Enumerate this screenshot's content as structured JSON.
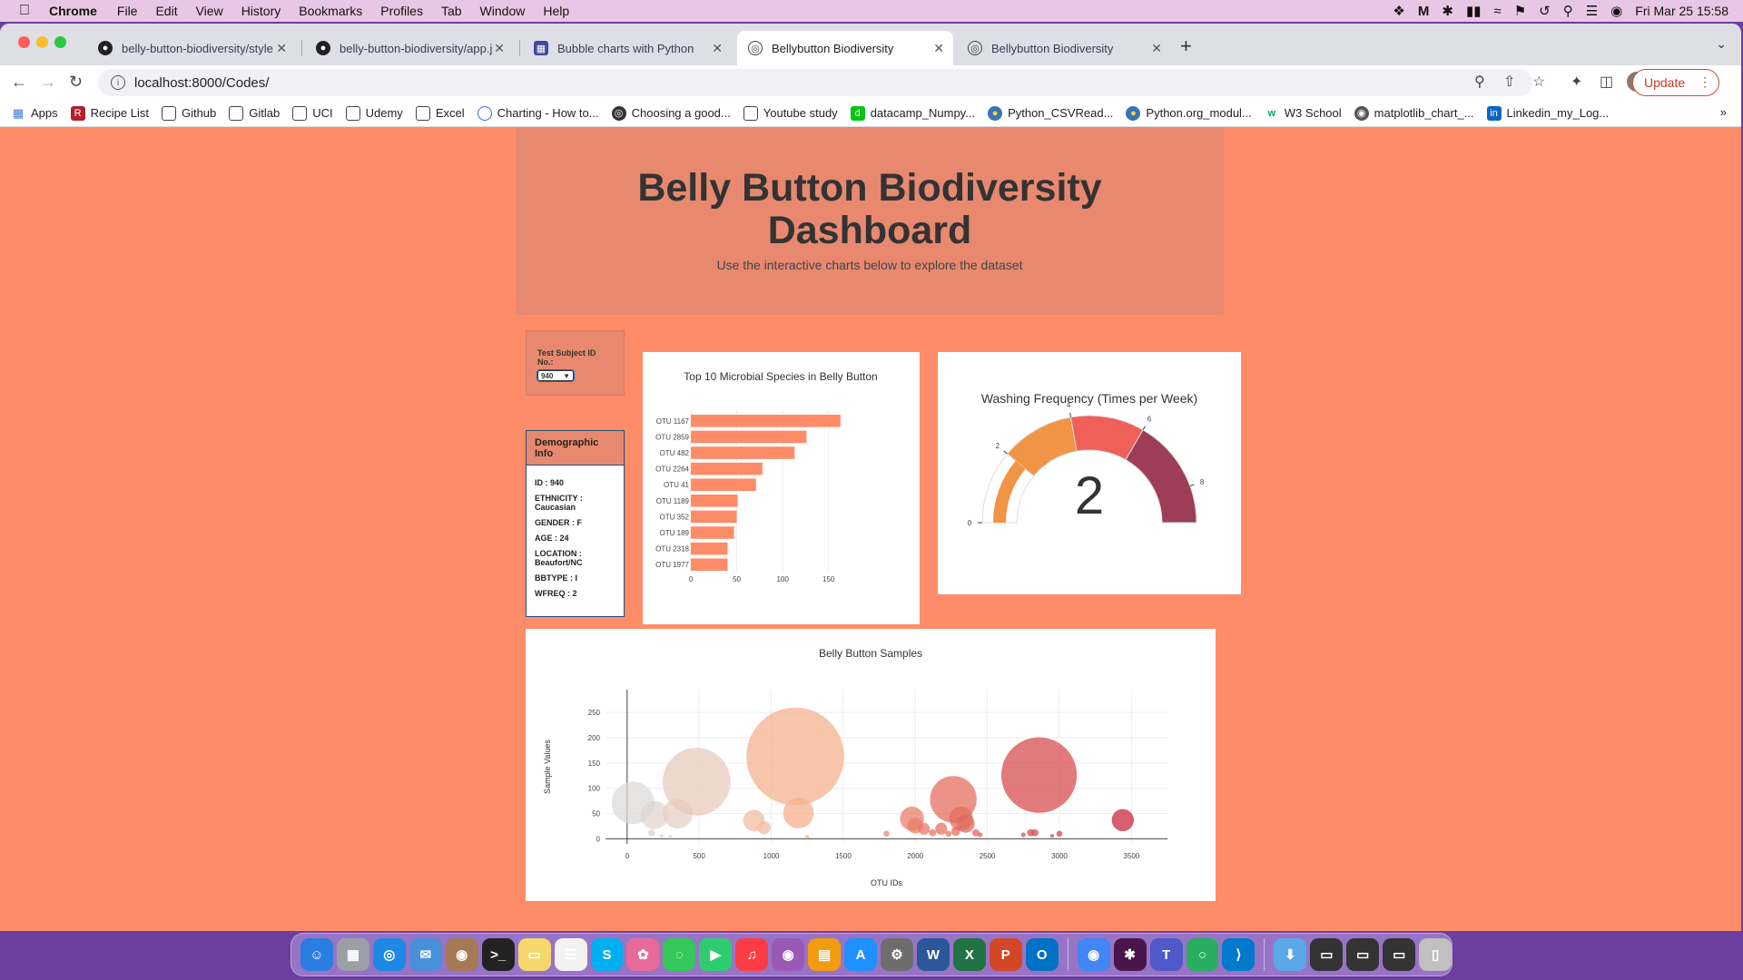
{
  "menubar": {
    "app": "Chrome",
    "items": [
      "File",
      "Edit",
      "View",
      "History",
      "Bookmarks",
      "Profiles",
      "Tab",
      "Window",
      "Help"
    ],
    "datetime": "Fri Mar 25  15:58"
  },
  "tabs": [
    {
      "label": "belly-button-biodiversity/style",
      "icon": "github-icon"
    },
    {
      "label": "belly-button-biodiversity/app.j",
      "icon": "github-icon"
    },
    {
      "label": "Bubble charts with Python",
      "icon": "plotly-icon"
    },
    {
      "label": "Bellybutton Biodiversity",
      "icon": "globe-icon",
      "active": true
    },
    {
      "label": "Bellybutton Biodiversity",
      "icon": "globe-icon"
    }
  ],
  "address": {
    "url": "localhost:8000/Codes/"
  },
  "update_label": "Update",
  "bookmarks": [
    {
      "label": "Apps",
      "icon": "apps-grid-icon"
    },
    {
      "label": "Recipe List",
      "icon": "recipe-icon"
    },
    {
      "label": "Github",
      "icon": "folder-icon"
    },
    {
      "label": "Gitlab",
      "icon": "folder-icon"
    },
    {
      "label": "UCI",
      "icon": "folder-icon"
    },
    {
      "label": "Udemy",
      "icon": "folder-icon"
    },
    {
      "label": "Excel",
      "icon": "folder-icon"
    },
    {
      "label": "Charting - How to...",
      "icon": "chart-site-icon"
    },
    {
      "label": "Choosing a good...",
      "icon": "globe-icon"
    },
    {
      "label": "Youtube study",
      "icon": "folder-icon"
    },
    {
      "label": "datacamp_Numpy...",
      "icon": "datacamp-icon"
    },
    {
      "label": "Python_CSVRead...",
      "icon": "python-icon"
    },
    {
      "label": "Python.org_modul...",
      "icon": "python-icon"
    },
    {
      "label": "W3 School",
      "icon": "w3-icon"
    },
    {
      "label": "matplotlib_chart_...",
      "icon": "matplotlib-icon"
    },
    {
      "label": "Linkedin_my_Log...",
      "icon": "linkedin-icon"
    }
  ],
  "header": {
    "title": "Belly Button Biodiversity Dashboard",
    "subtitle": "Use the interactive charts below to explore the dataset"
  },
  "selector": {
    "label": "Test Subject ID No.:",
    "selected": "940"
  },
  "demographic": {
    "title": "Demographic Info",
    "rows": [
      "ID : 940",
      "ETHNICITY : Caucasian",
      "GENDER : F",
      "AGE : 24",
      "LOCATION : Beaufort/NC",
      "BBTYPE : I",
      "WFREQ : 2"
    ]
  },
  "colors": {
    "page_bg": "#ff8c69",
    "panel_bg": "#e8896f",
    "bar": "#ff8c69"
  },
  "chart_data": [
    {
      "type": "bar",
      "orientation": "horizontal",
      "title": "Top 10 Microbial Species in Belly Button",
      "categories": [
        "OTU 1167",
        "OTU 2859",
        "OTU 482",
        "OTU 2264",
        "OTU 41",
        "OTU 1189",
        "OTU 352",
        "OTU 189",
        "OTU 2318",
        "OTU 1977"
      ],
      "values": [
        163,
        126,
        113,
        78,
        71,
        51,
        50,
        47,
        40,
        40
      ],
      "xticks": [
        0,
        50,
        100,
        150
      ],
      "xlim": [
        0,
        175
      ],
      "grid": true
    },
    {
      "type": "gauge",
      "title": "Washing Frequency (Times per Week)",
      "value": 2,
      "range": [
        0,
        9
      ],
      "ticks": [
        0,
        2,
        4,
        6,
        8
      ],
      "steps": [
        {
          "from": 0,
          "to": 2,
          "color": "#ffffff"
        },
        {
          "from": 2,
          "to": 4,
          "color": "#f29446"
        },
        {
          "from": 4,
          "to": 6,
          "color": "#ef6158"
        },
        {
          "from": 6,
          "to": 9,
          "color": "#9e3d57"
        }
      ]
    },
    {
      "type": "scatter",
      "mode": "bubble",
      "title": "Belly Button Samples",
      "xlabel": "OTU IDs",
      "ylabel": "Sample Values",
      "xticks": [
        0,
        500,
        1000,
        1500,
        2000,
        2500,
        3000,
        3500
      ],
      "yticks": [
        0,
        50,
        100,
        150,
        200,
        250
      ],
      "xlim": [
        -150,
        3750
      ],
      "ylim": [
        -10,
        295
      ],
      "grid": true,
      "points": [
        {
          "x": 41,
          "y": 71
        },
        {
          "x": 189,
          "y": 47
        },
        {
          "x": 352,
          "y": 50
        },
        {
          "x": 482,
          "y": 113
        },
        {
          "x": 1167,
          "y": 163
        },
        {
          "x": 1189,
          "y": 51
        },
        {
          "x": 2859,
          "y": 126
        },
        {
          "x": 2264,
          "y": 78
        },
        {
          "x": 2318,
          "y": 40
        },
        {
          "x": 1977,
          "y": 40
        },
        {
          "x": 3440,
          "y": 37
        },
        {
          "x": 880,
          "y": 36
        },
        {
          "x": 950,
          "y": 22
        },
        {
          "x": 2000,
          "y": 26
        },
        {
          "x": 2060,
          "y": 20
        },
        {
          "x": 2180,
          "y": 20
        },
        {
          "x": 2230,
          "y": 10
        },
        {
          "x": 2350,
          "y": 30
        },
        {
          "x": 2280,
          "y": 15
        },
        {
          "x": 2420,
          "y": 12
        },
        {
          "x": 170,
          "y": 12
        },
        {
          "x": 240,
          "y": 6
        },
        {
          "x": 300,
          "y": 4
        },
        {
          "x": 1250,
          "y": 4
        },
        {
          "x": 1800,
          "y": 10
        },
        {
          "x": 2450,
          "y": 8
        },
        {
          "x": 2750,
          "y": 8
        },
        {
          "x": 2800,
          "y": 12
        },
        {
          "x": 2830,
          "y": 12
        },
        {
          "x": 2950,
          "y": 6
        },
        {
          "x": 3000,
          "y": 10
        },
        {
          "x": 2120,
          "y": 12
        }
      ]
    }
  ],
  "dock": [
    "finder-icon",
    "launchpad-icon",
    "safari-icon",
    "mail-icon",
    "contacts-icon",
    "terminal-icon",
    "notes-icon",
    "reminders-icon",
    "skype-icon",
    "photos-icon",
    "messages-icon",
    "facetime-icon",
    "music-icon",
    "podcasts-icon",
    "books-icon",
    "appstore-icon",
    "settings-icon",
    "word-icon",
    "excel-icon",
    "powerpoint-icon",
    "outlook-icon",
    "chrome-icon",
    "slack-icon",
    "teams-icon",
    "circle-app-icon",
    "vscode-icon",
    "downloads-icon",
    "window-thumb-icon",
    "window-thumb-icon",
    "window-thumb-icon",
    "trash-icon"
  ]
}
